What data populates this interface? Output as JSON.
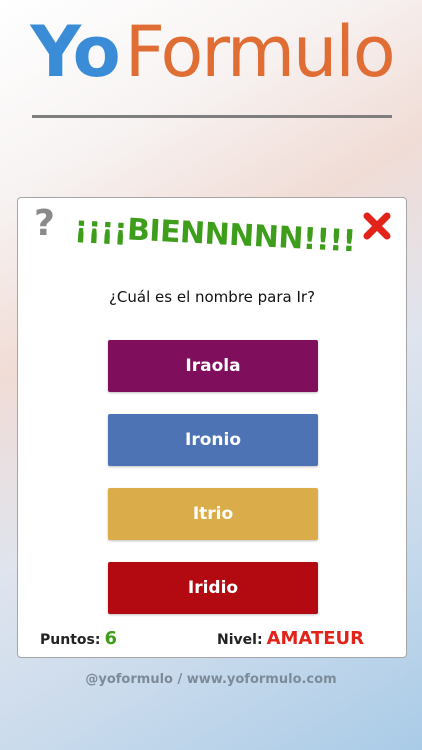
{
  "logo": {
    "part1": "Yo",
    "part2": "Formulo",
    "part1_color": "#3a8cd6",
    "part2_color": "#e06d33"
  },
  "card": {
    "help_icon": "?",
    "close_icon_name": "close-icon",
    "close_icon_color": "#e2231a",
    "feedback": "¡¡¡¡BIENNNNN!!!!",
    "feedback_color": "#3f9d1c",
    "question": "¿Cuál es el nombre para Ir?",
    "answers": [
      {
        "label": "Iraola",
        "color": "#7f0f5d"
      },
      {
        "label": "Ironio",
        "color": "#4e73b5"
      },
      {
        "label": "Itrio",
        "color": "#dbac4a"
      },
      {
        "label": "Iridio",
        "color": "#b30a12"
      }
    ],
    "score_label": "Puntos:",
    "score_value": "6",
    "level_label": "Nivel:",
    "level_value": "AMATEUR"
  },
  "credit": "@yoformulo / www.yoformulo.com"
}
